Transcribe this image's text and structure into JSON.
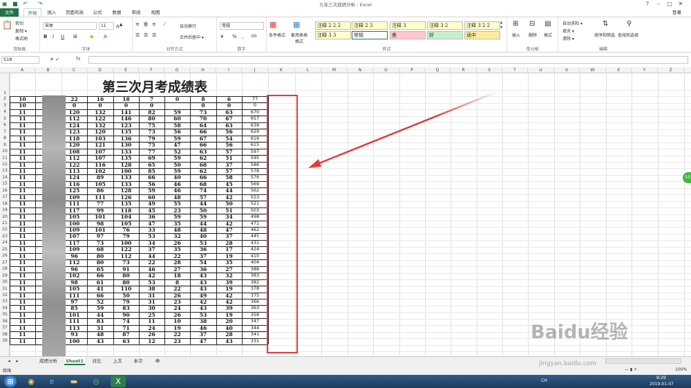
{
  "window": {
    "title": "九年三次成绩分析 - Excel",
    "login": "登录"
  },
  "tabs": [
    "文件",
    "开始",
    "插入",
    "页面布局",
    "公式",
    "数据",
    "审阅",
    "视图"
  ],
  "ribbon": {
    "clipboard": {
      "cut": "剪切",
      "copy": "复制 ▾",
      "format_painter": "格式刷",
      "label": "剪贴板"
    },
    "font": {
      "name": "宋体",
      "size": "11",
      "label": "字体"
    },
    "alignment": {
      "wrap": "自动换行",
      "merge": "合并后居中 ▾",
      "label": "对齐方式"
    },
    "number": {
      "format": "常规",
      "label": "数字"
    },
    "styles": {
      "conditional": "条件格式",
      "table": "套用表格格式",
      "label": "样式",
      "cells": [
        {
          "text": "注释 2 2 2",
          "bg": "#ffffcc"
        },
        {
          "text": "注释 2 3",
          "bg": "#ffffcc"
        },
        {
          "text": "注释 3",
          "bg": "#ffffcc"
        },
        {
          "text": "注释 3 2",
          "bg": "#ffffcc"
        },
        {
          "text": "注释 3 2 2",
          "bg": "#ffffcc"
        },
        {
          "text": "注释 3 3",
          "bg": "#ffffcc"
        },
        {
          "text": "常规",
          "bg": "#ffffff"
        },
        {
          "text": "差",
          "bg": "#ffc7ce"
        },
        {
          "text": "好",
          "bg": "#c6efce"
        },
        {
          "text": "适中",
          "bg": "#ffeb9c"
        }
      ]
    },
    "cells_grp": {
      "insert": "插入",
      "delete": "删除",
      "format": "格式",
      "label": "单元格"
    },
    "editing": {
      "autosum": "自动求和 ▾",
      "fill": "填充 ▾",
      "clear": "清除 ▾",
      "sort": "排序和筛选",
      "find": "查找和选择",
      "label": "编辑"
    }
  },
  "formula_bar": {
    "name_box": "S18",
    "fx": "fx"
  },
  "columns": [
    "A",
    "B",
    "C",
    "D",
    "E",
    "F",
    "G",
    "H",
    "I",
    "J",
    "K",
    "L",
    "M",
    "N",
    "O",
    "P",
    "Q",
    "R",
    "S",
    "T",
    "U",
    "V",
    "W",
    "X",
    "Y",
    "Z"
  ],
  "sheet_title": "第三次月考成绩表",
  "rows": [
    [
      "10",
      "",
      "22",
      "16",
      "18",
      "7",
      "0",
      "8",
      "6",
      "77"
    ],
    [
      "10",
      "",
      "0",
      "0",
      "0",
      "0",
      "",
      "0",
      "0",
      "0"
    ],
    [
      "11",
      "",
      "120",
      "132",
      "141",
      "82",
      "59",
      "73",
      "63",
      "670"
    ],
    [
      "11",
      "",
      "112",
      "122",
      "146",
      "80",
      "60",
      "70",
      "67",
      "657"
    ],
    [
      "11",
      "",
      "124",
      "132",
      "123",
      "75",
      "58",
      "64",
      "63",
      "639"
    ],
    [
      "11",
      "",
      "123",
      "120",
      "135",
      "73",
      "56",
      "66",
      "56",
      "629"
    ],
    [
      "11",
      "",
      "118",
      "103",
      "136",
      "79",
      "59",
      "67",
      "54",
      "616"
    ],
    [
      "11",
      "",
      "120",
      "121",
      "130",
      "75",
      "47",
      "66",
      "56",
      "615"
    ],
    [
      "11",
      "",
      "108",
      "107",
      "133",
      "77",
      "52",
      "63",
      "57",
      "597"
    ],
    [
      "11",
      "",
      "112",
      "107",
      "135",
      "69",
      "59",
      "62",
      "51",
      "595"
    ],
    [
      "11",
      "",
      "122",
      "116",
      "128",
      "65",
      "50",
      "68",
      "37",
      "586"
    ],
    [
      "11",
      "",
      "113",
      "102",
      "100",
      "85",
      "59",
      "62",
      "57",
      "578"
    ],
    [
      "11",
      "",
      "124",
      "89",
      "133",
      "66",
      "40",
      "66",
      "58",
      "576"
    ],
    [
      "11",
      "",
      "116",
      "105",
      "133",
      "56",
      "46",
      "68",
      "45",
      "569"
    ],
    [
      "11",
      "",
      "125",
      "86",
      "128",
      "59",
      "46",
      "74",
      "44",
      "562"
    ],
    [
      "11",
      "",
      "109",
      "111",
      "126",
      "60",
      "48",
      "57",
      "42",
      "553"
    ],
    [
      "11",
      "",
      "111",
      "77",
      "135",
      "49",
      "55",
      "44",
      "50",
      "521"
    ],
    [
      "11",
      "",
      "117",
      "99",
      "118",
      "45",
      "23",
      "50",
      "51",
      "503"
    ],
    [
      "11",
      "",
      "105",
      "101",
      "104",
      "36",
      "59",
      "59",
      "34",
      "498"
    ],
    [
      "11",
      "",
      "100",
      "98",
      "105",
      "47",
      "35",
      "44",
      "42",
      "471"
    ],
    [
      "11",
      "",
      "109",
      "101",
      "76",
      "33",
      "48",
      "48",
      "47",
      "462"
    ],
    [
      "11",
      "",
      "107",
      "97",
      "79",
      "53",
      "32",
      "40",
      "37",
      "445"
    ],
    [
      "11",
      "",
      "117",
      "73",
      "100",
      "34",
      "26",
      "53",
      "28",
      "431"
    ],
    [
      "11",
      "",
      "109",
      "68",
      "122",
      "37",
      "35",
      "36",
      "17",
      "424"
    ],
    [
      "11",
      "",
      "96",
      "80",
      "112",
      "44",
      "22",
      "37",
      "19",
      "410"
    ],
    [
      "11",
      "",
      "112",
      "80",
      "73",
      "22",
      "28",
      "54",
      "35",
      "404"
    ],
    [
      "11",
      "",
      "96",
      "65",
      "91",
      "46",
      "27",
      "36",
      "27",
      "388"
    ],
    [
      "11",
      "",
      "102",
      "66",
      "80",
      "42",
      "18",
      "43",
      "32",
      "383"
    ],
    [
      "11",
      "",
      "98",
      "61",
      "80",
      "53",
      "8",
      "43",
      "39",
      "382"
    ],
    [
      "11",
      "",
      "105",
      "41",
      "110",
      "38",
      "22",
      "43",
      "19",
      "378"
    ],
    [
      "11",
      "",
      "111",
      "66",
      "50",
      "31",
      "26",
      "49",
      "42",
      "375"
    ],
    [
      "11",
      "",
      "97",
      "52",
      "79",
      "31",
      "23",
      "42",
      "42",
      "366"
    ],
    [
      "11",
      "",
      "85",
      "59",
      "83",
      "30",
      "24",
      "43",
      "39",
      "363"
    ],
    [
      "11",
      "",
      "101",
      "44",
      "90",
      "25",
      "26",
      "53",
      "19",
      "358"
    ],
    [
      "11",
      "",
      "111",
      "83",
      "74",
      "11",
      "10",
      "38",
      "20",
      "347"
    ],
    [
      "11",
      "",
      "113",
      "31",
      "71",
      "24",
      "19",
      "46",
      "40",
      "344"
    ],
    [
      "11",
      "",
      "93",
      "48",
      "87",
      "26",
      "22",
      "37",
      "28",
      "341"
    ],
    [
      "11",
      "",
      "100",
      "43",
      "63",
      "12",
      "23",
      "47",
      "43",
      "331"
    ]
  ],
  "sheet_tabs": [
    "成绩分析",
    "Sheet1",
    "对比",
    "上次",
    "本次"
  ],
  "active_sheet": "Sheet1",
  "status": {
    "ready": "就绪",
    "zoom": "100%"
  },
  "taskbar": {
    "time": "8:29",
    "date": "2019-01-07",
    "ch": "CH"
  },
  "watermark": {
    "logo": "Baidu经验",
    "url": "jingyan.baidu.com"
  }
}
